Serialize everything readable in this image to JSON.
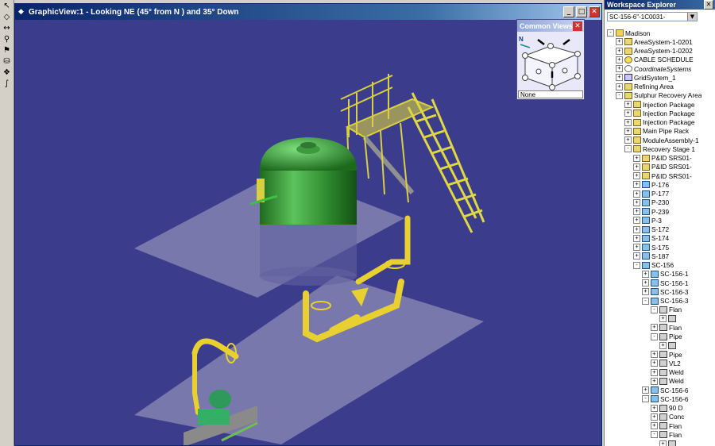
{
  "toolbar": {
    "tools": [
      {
        "name": "select-tool",
        "icon": "select-arrow-icon",
        "glyph": "↖"
      },
      {
        "name": "view-tool",
        "icon": "view-icon",
        "glyph": "◇"
      },
      {
        "name": "fit-tool",
        "icon": "fit-icon",
        "glyph": "↔"
      },
      {
        "name": "route-tool",
        "icon": "route-icon",
        "glyph": "⚲"
      },
      {
        "name": "place-tool",
        "icon": "place-icon",
        "glyph": "⚑"
      },
      {
        "name": "equipment-tool",
        "icon": "equipment-icon",
        "glyph": "⛁"
      },
      {
        "name": "component-tool",
        "icon": "component-icon",
        "glyph": "❖"
      },
      {
        "name": "measure-tool",
        "icon": "measure-icon",
        "glyph": "∫"
      }
    ]
  },
  "graphic_view": {
    "title": "GraphicView:1 - Looking NE (45° from N ) and 35° Down",
    "background_color": "#3c3c8c",
    "minimize_glyph": "_",
    "maximize_glyph": "□",
    "close_glyph": "✕"
  },
  "common_views": {
    "title": "Common Views",
    "close_glyph": "✕",
    "compass_label": "N",
    "status": "None"
  },
  "workspace_explorer": {
    "title": "Workspace Explorer",
    "close_glyph": "✕",
    "filter_value": "SC-156-6\"-1C0031-",
    "combo_arrow": "▼",
    "tree": [
      {
        "label": "Madison",
        "depth": 0,
        "exp": "-",
        "icon": "folder"
      },
      {
        "label": "AreaSystem-1-0201",
        "depth": 1,
        "exp": "+",
        "icon": "system"
      },
      {
        "label": "AreaSystem-1-0202",
        "depth": 1,
        "exp": "+",
        "icon": "system"
      },
      {
        "label": "CABLE SCHEDULE",
        "depth": 1,
        "exp": "+",
        "icon": "cable"
      },
      {
        "label": "CoordinateSystems",
        "depth": 1,
        "exp": "+",
        "icon": "coord",
        "italic": true
      },
      {
        "label": "GridSystem_1",
        "depth": 1,
        "exp": "+",
        "icon": "grid"
      },
      {
        "label": "Refining Area",
        "depth": 1,
        "exp": "+",
        "icon": "system"
      },
      {
        "label": "Sulphur Recovery Area",
        "depth": 1,
        "exp": "-",
        "icon": "system"
      },
      {
        "label": "Injection Package",
        "depth": 2,
        "exp": "+",
        "icon": "system"
      },
      {
        "label": "Injection Package",
        "depth": 2,
        "exp": "+",
        "icon": "system"
      },
      {
        "label": "Injection Package",
        "depth": 2,
        "exp": "+",
        "icon": "system"
      },
      {
        "label": "Main Pipe Rack",
        "depth": 2,
        "exp": "+",
        "icon": "system"
      },
      {
        "label": "ModuleAssembly-1",
        "depth": 2,
        "exp": "+",
        "icon": "system"
      },
      {
        "label": "Recovery Stage 1",
        "depth": 2,
        "exp": "-",
        "icon": "system"
      },
      {
        "label": "P&ID SRS01-",
        "depth": 3,
        "exp": "+",
        "icon": "system"
      },
      {
        "label": "P&ID SRS01-",
        "depth": 3,
        "exp": "+",
        "icon": "system"
      },
      {
        "label": "P&ID SRS01-",
        "depth": 3,
        "exp": "+",
        "icon": "system"
      },
      {
        "label": "P-176",
        "depth": 3,
        "exp": "+",
        "icon": "pipe"
      },
      {
        "label": "P-177",
        "depth": 3,
        "exp": "+",
        "icon": "pipe"
      },
      {
        "label": "P-230",
        "depth": 3,
        "exp": "+",
        "icon": "pipe"
      },
      {
        "label": "P-239",
        "depth": 3,
        "exp": "+",
        "icon": "pipe"
      },
      {
        "label": "P-3",
        "depth": 3,
        "exp": "+",
        "icon": "pipe"
      },
      {
        "label": "S-172",
        "depth": 3,
        "exp": "+",
        "icon": "pipe"
      },
      {
        "label": "S-174",
        "depth": 3,
        "exp": "+",
        "icon": "pipe"
      },
      {
        "label": "S-175",
        "depth": 3,
        "exp": "+",
        "icon": "pipe"
      },
      {
        "label": "S-187",
        "depth": 3,
        "exp": "+",
        "icon": "pipe"
      },
      {
        "label": "SC-156",
        "depth": 3,
        "exp": "-",
        "icon": "pipe"
      },
      {
        "label": "SC-156-1",
        "depth": 4,
        "exp": "+",
        "icon": "pipe"
      },
      {
        "label": "SC-156-1",
        "depth": 4,
        "exp": "+",
        "icon": "pipe"
      },
      {
        "label": "SC-156-3",
        "depth": 4,
        "exp": "+",
        "icon": "pipe"
      },
      {
        "label": "SC-156-3",
        "depth": 4,
        "exp": "-",
        "icon": "pipe"
      },
      {
        "label": "Flan",
        "depth": 5,
        "exp": "-",
        "icon": "fitting"
      },
      {
        "label": "",
        "depth": 6,
        "exp": "+",
        "icon": "fitting"
      },
      {
        "label": "Flan",
        "depth": 5,
        "exp": "+",
        "icon": "fitting"
      },
      {
        "label": "Pipe",
        "depth": 5,
        "exp": "-",
        "icon": "fitting"
      },
      {
        "label": "",
        "depth": 6,
        "exp": "+",
        "icon": "fitting"
      },
      {
        "label": "Pipe",
        "depth": 5,
        "exp": "+",
        "icon": "fitting"
      },
      {
        "label": "VL2",
        "depth": 5,
        "exp": "+",
        "icon": "fitting"
      },
      {
        "label": "Weld",
        "depth": 5,
        "exp": "+",
        "icon": "fitting"
      },
      {
        "label": "Weld",
        "depth": 5,
        "exp": "+",
        "icon": "fitting"
      },
      {
        "label": "SC-156-6",
        "depth": 4,
        "exp": "+",
        "icon": "pipe"
      },
      {
        "label": "SC-156-6",
        "depth": 4,
        "exp": "-",
        "icon": "pipe"
      },
      {
        "label": "90 D",
        "depth": 5,
        "exp": "+",
        "icon": "fitting"
      },
      {
        "label": "Conc",
        "depth": 5,
        "exp": "+",
        "icon": "fitting"
      },
      {
        "label": "Flan",
        "depth": 5,
        "exp": "+",
        "icon": "fitting"
      },
      {
        "label": "Flan",
        "depth": 5,
        "exp": "-",
        "icon": "fitting"
      },
      {
        "label": "",
        "depth": 6,
        "exp": "+",
        "icon": "fitting"
      }
    ]
  }
}
